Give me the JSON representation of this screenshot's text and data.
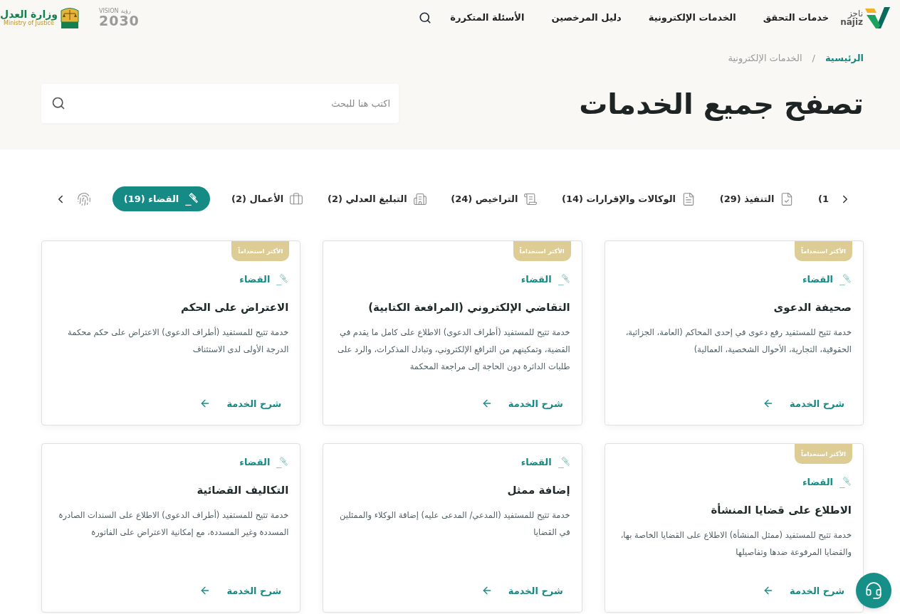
{
  "header": {
    "logo": {
      "name_ar": "ناجز",
      "name_en": "najiz"
    },
    "nav": [
      "خدمات التحقق",
      "الخدمات الإلكترونية",
      "دليل المرخصين",
      "الأسئلة المتكررة"
    ],
    "partner_logos": {
      "vision": {
        "label": "VISION",
        "label_ar": "رؤية",
        "year": "2030"
      },
      "ministry": {
        "name_ar": "وزارة العدل",
        "name_en": "Ministry of Justice"
      }
    }
  },
  "breadcrumb": {
    "separator": "/",
    "items": [
      {
        "label": "الرئيسية",
        "current": false
      },
      {
        "label": "الخدمات الإلكترونية",
        "current": true
      }
    ]
  },
  "page_title": "تصفح جميع الخدمات",
  "search": {
    "placeholder": "اكتب هنا للبحث"
  },
  "category_tabs": [
    {
      "label": "(1",
      "selected": false
    },
    {
      "label": "التنفيذ (29)",
      "selected": false
    },
    {
      "label": "الوكالات والإقرارات (14)",
      "selected": false
    },
    {
      "label": "التراخيص (24)",
      "selected": false
    },
    {
      "label": "التبليغ العدلي (2)",
      "selected": false
    },
    {
      "label": "الأعمال (2)",
      "selected": false
    },
    {
      "label": "القضاء (19)",
      "selected": true
    },
    {
      "selected": false
    }
  ],
  "services": [
    {
      "badge": "الأكثر استخداماً",
      "category": "القضاء",
      "title": "صحيفة الدعوى",
      "description": "خدمة تتيح للمستفيد رفع دعوى في إحدى المحاكم (العامة، الجزائية، الحقوقية، التجارية، الأحوال الشخصية، العمالية)",
      "link": "شرح الخدمة"
    },
    {
      "badge": "الأكثر استخداماً",
      "category": "القضاء",
      "title": "التقاضي الإلكتروني (المرافعة الكتابية)",
      "description": "خدمة تتيح للمستفيد (أطراف الدعوى) الاطلاع على كامل ما يقدم في القضية، وتمكينهم من الترافع الإلكتروني، وتبادل المذكرات، والرد على طلبات الدائرة دون الحاجة إلى مراجعة المحكمة",
      "link": "شرح الخدمة"
    },
    {
      "badge": "الأكثر استخداماً",
      "category": "القضاء",
      "title": "الاعتراض على الحكم",
      "description": "خدمة تتيح للمستفيد (أطراف الدعوى) الاعتراض على حكم محكمة الدرجة الأولى لدى الاستئناف",
      "link": "شرح الخدمة"
    },
    {
      "badge": "الأكثر استخداماً",
      "category": "القضاء",
      "title": "الاطلاع على قضايا المنشأة",
      "description": "خدمة تتيح للمستفيد (ممثل المنشأة) الاطلاع على القضايا الخاصة بها، والقضايا المرفوعة ضدها وتفاصيلها",
      "link": "شرح الخدمة"
    },
    {
      "category": "القضاء",
      "title": "إضافة ممثل",
      "description": "خدمة تتيح للمستفيد (المدعي/ المدعى عليه) إضافة الوكلاء والممثلين في القضايا",
      "link": "شرح الخدمة"
    },
    {
      "category": "القضاء",
      "title": "التكاليف القضائية",
      "description": "خدمة تتيح للمستفيد (أطراف الدعوى) الاطلاع على السندات الصادرة المسددة وغير المسددة، مع إمكانية الاعتراض على الفاتورة",
      "link": "شرح الخدمة"
    }
  ]
}
